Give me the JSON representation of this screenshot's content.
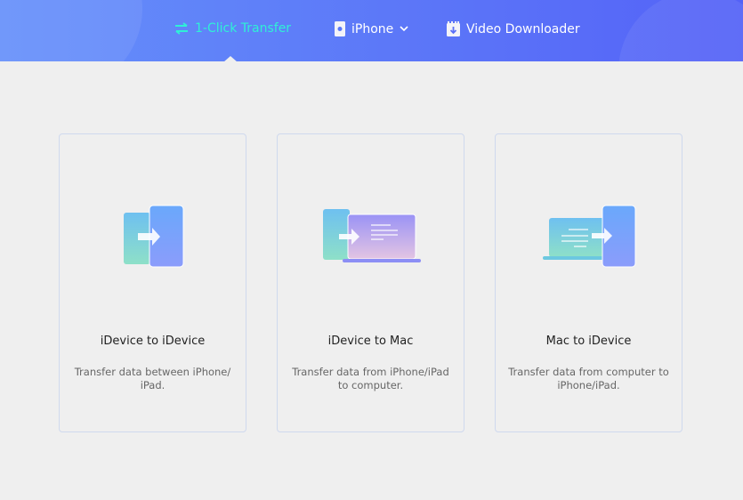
{
  "nav": {
    "transfer": "1-Click Transfer",
    "device": "iPhone",
    "downloader": "Video Downloader"
  },
  "colors": {
    "accent": "#2ff0d6",
    "header_start": "#6590fa",
    "header_end": "#5462f7"
  },
  "cards": [
    {
      "title": "iDevice to iDevice",
      "desc": "Transfer data between iPhone/ iPad."
    },
    {
      "title": "iDevice to Mac",
      "desc": "Transfer data from iPhone/iPad to computer."
    },
    {
      "title": "Mac to iDevice",
      "desc": "Transfer data from computer to iPhone/iPad."
    }
  ]
}
